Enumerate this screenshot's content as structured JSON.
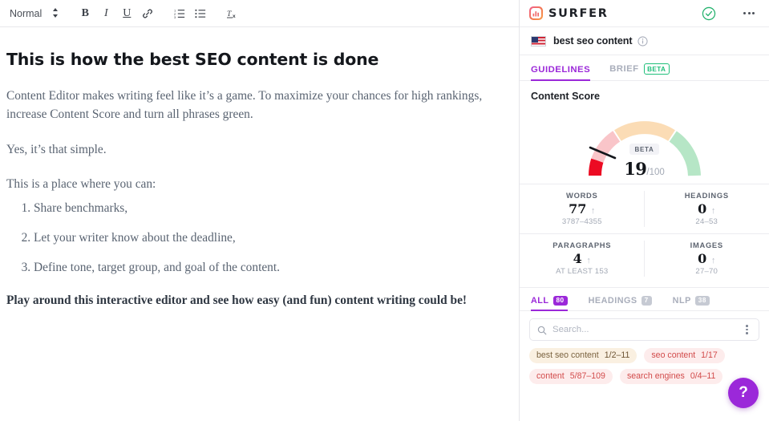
{
  "editor": {
    "toolbar": {
      "style_label": "Normal",
      "updown_icon": "updown-arrows-icon",
      "bold_label": "B",
      "italic_label": "I",
      "underline_label": "U",
      "link_icon": "link-icon",
      "ordered_list_icon": "ordered-list-icon",
      "bullet_list_icon": "bullet-list-icon",
      "clear_format_icon": "clear-formatting-icon"
    },
    "document": {
      "title": "This is how the best SEO content is done",
      "paragraph1": "Content Editor makes writing feel like it’s a game. To maximize your chances for high rankings, increase Content Score and turn all phrases green.",
      "paragraph2": "Yes, it’s that simple.",
      "paragraph3": "This is a place where you can:",
      "list": [
        "Share benchmarks,",
        "Let your writer know about the deadline,",
        "Define tone, target group, and goal of the content."
      ],
      "closing": "Play around this interactive editor and see how easy (and fun) content writing could be!"
    }
  },
  "panel": {
    "brand": "SURFER",
    "status_icon": "check-circle-icon",
    "menu_icon": "more-options-icon",
    "keyword": {
      "flag_icon": "us-flag-icon",
      "text": "best seo content",
      "info_icon": "info-icon"
    },
    "tabs": [
      {
        "label": "GUIDELINES",
        "active": true
      },
      {
        "label": "BRIEF",
        "active": false,
        "pill": "BETA"
      }
    ],
    "content_score": {
      "section_title": "Content Score",
      "beta_tag": "BETA",
      "value": "19",
      "denominator": "/100"
    },
    "metrics": [
      {
        "label": "WORDS",
        "value": "77",
        "arrow": "↑",
        "range": "3787–4355"
      },
      {
        "label": "HEADINGS",
        "value": "0",
        "arrow": "↑",
        "range": "24–53"
      },
      {
        "label": "PARAGRAPHS",
        "value": "4",
        "arrow": "↑",
        "range": "AT LEAST 153"
      },
      {
        "label": "IMAGES",
        "value": "0",
        "arrow": "↑",
        "range": "27–70"
      }
    ],
    "filter_tabs": [
      {
        "label": "ALL",
        "badge": "80",
        "active": true
      },
      {
        "label": "HEADINGS",
        "badge": "7",
        "active": false
      },
      {
        "label": "NLP",
        "badge": "38",
        "active": false
      }
    ],
    "search": {
      "icon": "search-icon",
      "placeholder": "Search...",
      "value": "",
      "menu_icon": "vertical-dots-icon"
    },
    "chips": [
      {
        "word": "best seo content",
        "count": "1/2–11",
        "tone": "tan"
      },
      {
        "word": "seo content",
        "count": "1/17",
        "tone": "red"
      },
      {
        "word": "content",
        "count": "5/87–109",
        "tone": "red"
      },
      {
        "word": "search engines",
        "count": "0/4–11",
        "tone": "red"
      }
    ],
    "help_label": "?"
  },
  "chart_data": {
    "type": "gauge",
    "title": "Content Score",
    "value": 19,
    "min": 0,
    "max": 100,
    "unit": "/100",
    "bands": [
      {
        "name": "poor",
        "from": 0,
        "to": 14,
        "color": "#ec0b23"
      },
      {
        "name": "weak",
        "from": 14,
        "to": 33,
        "color": "#f9c5c9"
      },
      {
        "name": "medium",
        "from": 33,
        "to": 66,
        "color": "#fbdcb5"
      },
      {
        "name": "good",
        "from": 66,
        "to": 100,
        "color": "#b6e6c6"
      }
    ],
    "needle_value": 19,
    "legend": [
      "BETA"
    ]
  },
  "colors": {
    "accent": "#9b28d9",
    "brand_gradient_start": "#f06191",
    "brand_gradient_end": "#f9a24c",
    "success": "#23b26d",
    "score_red": "#ec0b23",
    "chip_tan_bg": "#faf0e1",
    "chip_red_bg": "#fdecec"
  }
}
